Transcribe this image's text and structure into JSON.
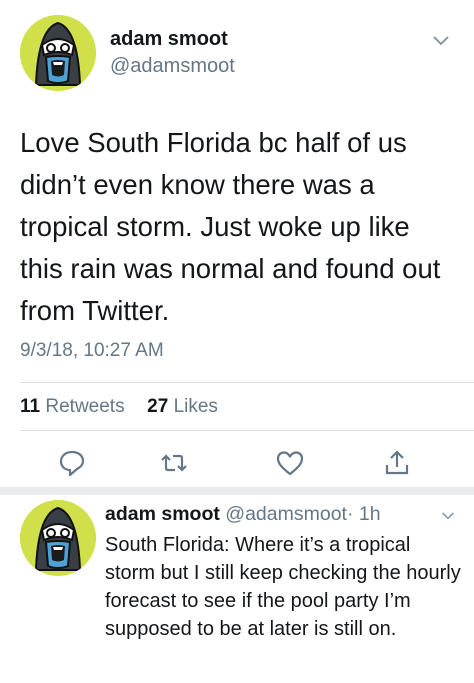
{
  "tweet": {
    "name": "adam smoot",
    "handle": "@adamsmoot",
    "text": "Love South Florida bc half of us didn’t even know there was a tropical storm. Just woke up like this rain was normal and found out from Twitter.",
    "timestamp": "9/3/18, 10:27 AM",
    "retweets_count": "11",
    "retweets_label": "Retweets",
    "likes_count": "27",
    "likes_label": "Likes"
  },
  "actions": {
    "icons": [
      "reply-icon",
      "retweet-icon",
      "like-icon",
      "share-icon"
    ]
  },
  "reply": {
    "name": "adam smoot",
    "handle": "@adamsmoot",
    "time": "· 1h",
    "text": "South Florida: Where it’s a tropical storm but I still keep checking the hourly forecast to see if the pool party I’m supposed to be at later is still on."
  },
  "colors": {
    "avatar_background": "#cfe04a",
    "secondary_text": "#657786",
    "primary_text": "#14171a"
  }
}
